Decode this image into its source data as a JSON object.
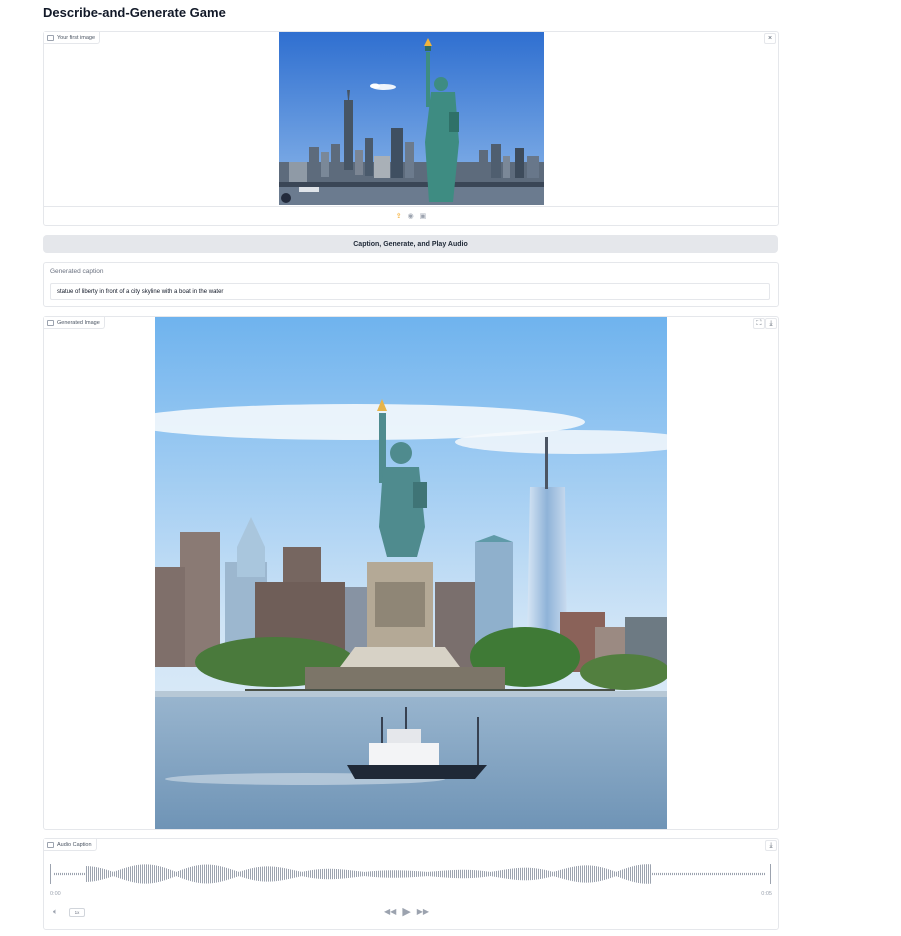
{
  "page": {
    "title": "Describe-and-Generate Game"
  },
  "input_image": {
    "label": "Your first image",
    "close_icon": "×",
    "toolbar": [
      "upload-icon",
      "webcam-icon",
      "clipboard-icon"
    ]
  },
  "generate_button": {
    "label": "Caption, Generate, and Play Audio"
  },
  "caption": {
    "label": "Generated caption",
    "value": "statue of liberty in front of a city skyline with a boat in the water"
  },
  "generated_image": {
    "label": "Generated Image",
    "icons": [
      "fullscreen-icon",
      "download-icon"
    ]
  },
  "audio": {
    "label": "Audio Caption",
    "time_start": "0:00",
    "time_end": "0:05",
    "playback_rate": "1x",
    "icons": [
      "download-icon",
      "volume-icon",
      "rewind-icon",
      "play-icon",
      "forward-icon"
    ]
  },
  "colors": {
    "accent": "#f59e0b",
    "button_bg": "#e5e7eb",
    "border": "#e5e7eb",
    "waveform": "#9ca3af"
  }
}
